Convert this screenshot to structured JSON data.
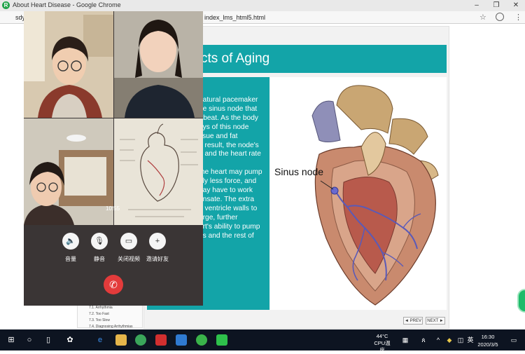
{
  "browser": {
    "title": "About Heart Disease - Google Chrome",
    "address_prefix": "sdy",
    "address_suffix": "index_lms_html5.html",
    "logo_letter": "R"
  },
  "slide": {
    "title": "cts of Aging",
    "text_lines": [
      "natural pacemaker",
      "he sinus node that",
      "rtbeat. As the body",
      "ays of this node",
      "ssue and fat",
      "a result, the node's",
      "e and the heart rate",
      "",
      "the heart may pump",
      "ely less force, and",
      "nay have to work",
      "ensate. The extra",
      "e ventricle walls to",
      "arge, further",
      "art's ability to pump",
      "gs and the rest of"
    ],
    "image_label": "Sinus node",
    "prev_label": "◄ PREV",
    "next_label": "NEXT ►"
  },
  "toc": {
    "items": [
      "7.1. Arrhythmia",
      "7.2. Too Fast",
      "7.3. Too Slow",
      "7.4. Diagnosing Arrhythmias"
    ]
  },
  "call": {
    "time": "10:55",
    "buttons": [
      {
        "label": "音量",
        "icon": "speaker-icon"
      },
      {
        "label": "静音",
        "icon": "microphone-icon"
      },
      {
        "label": "关闭视频",
        "icon": "video-camera-icon"
      },
      {
        "label": "邀请好友",
        "icon": "add-person-icon"
      }
    ]
  },
  "taskbar": {
    "temp": "44°C",
    "temp_label": "CPU温度",
    "time": "16:30",
    "date": "2020/3/5",
    "ime": "英"
  },
  "colors": {
    "accent": "#13a4a8",
    "hangup": "#e33b3b",
    "taskbar": "#0d1421"
  }
}
